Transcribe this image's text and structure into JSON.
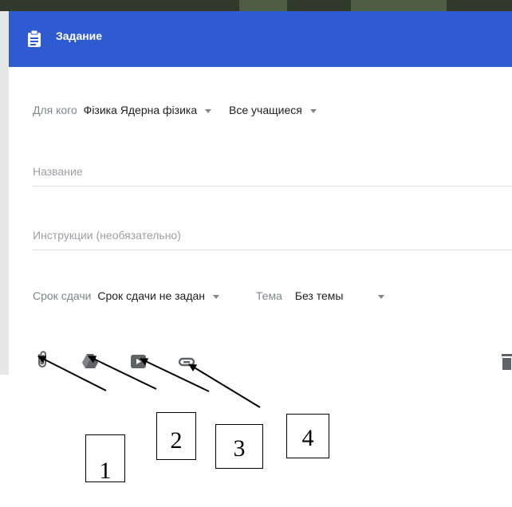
{
  "header": {
    "title": "Задание"
  },
  "audience": {
    "label": "Для кого",
    "course": "Фізика Ядерна фізика",
    "students": "Все учащиеся"
  },
  "fields": {
    "title_placeholder": "Название",
    "instructions_placeholder": "Инструкции (необязательно)"
  },
  "due": {
    "label": "Срок сдачи",
    "value": "Срок сдачи не задан"
  },
  "topic": {
    "label": "Тема",
    "value": "Без темы"
  },
  "attach_icons": [
    "paperclip-icon",
    "drive-icon",
    "youtube-icon",
    "link-icon"
  ],
  "callouts": [
    "1",
    "2",
    "3",
    "4"
  ],
  "colors": {
    "header": "#2f5bd0",
    "muted": "#80868b"
  }
}
